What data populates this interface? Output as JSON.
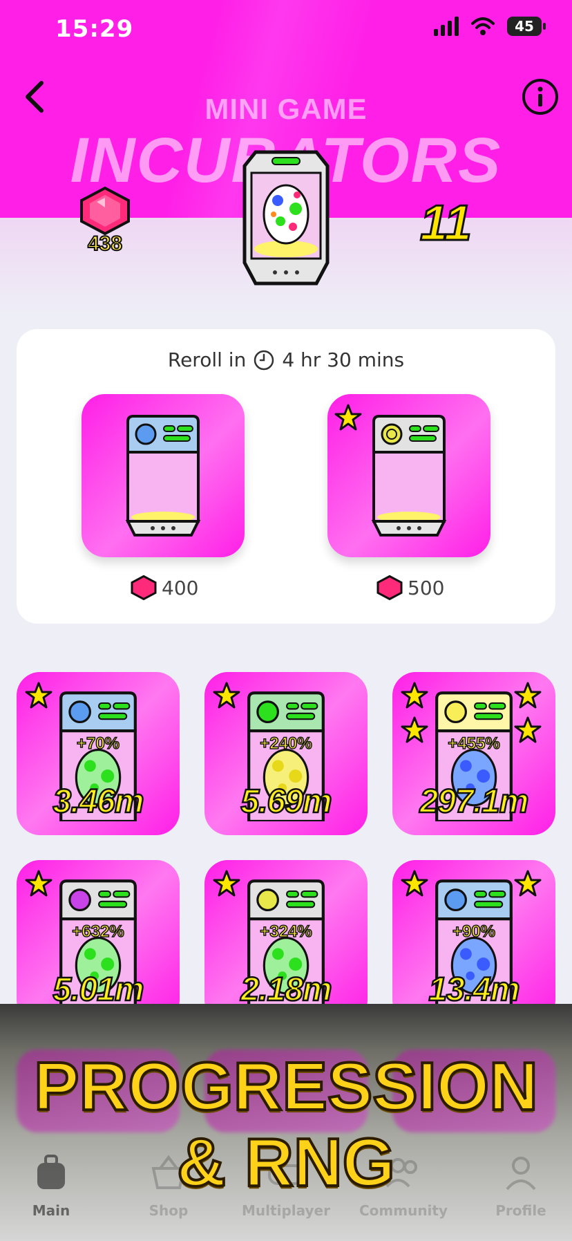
{
  "status": {
    "time": "15:29",
    "battery": "45"
  },
  "header": {
    "subtitle": "MINI GAME",
    "title": "INCUBATORS"
  },
  "balance": {
    "gems": "438",
    "level": "11"
  },
  "reroll": {
    "label": "Reroll in",
    "time": "4 hr 30 mins"
  },
  "shop": [
    {
      "price": "400",
      "starred": false,
      "accent": "#8fc3ff"
    },
    {
      "price": "500",
      "starred": true,
      "accent": "#e8e84a"
    }
  ],
  "incubators": [
    {
      "percent": "+70%",
      "value": "3.46m",
      "stars": 1
    },
    {
      "percent": "+240%",
      "value": "5.69m",
      "stars": 1
    },
    {
      "percent": "+455%",
      "value": "297.1m",
      "stars": 4
    },
    {
      "percent": "+632%",
      "value": "5.01m",
      "stars": 1
    },
    {
      "percent": "+324%",
      "value": "2.18m",
      "stars": 1
    },
    {
      "percent": "+90%",
      "value": "13.4m",
      "stars": 2
    }
  ],
  "nav": [
    {
      "label": "Main",
      "icon": "backpack-icon"
    },
    {
      "label": "Shop",
      "icon": "basket-icon"
    },
    {
      "label": "Multiplayer",
      "icon": "controller-icon"
    },
    {
      "label": "Community",
      "icon": "people-icon"
    },
    {
      "label": "Profile",
      "icon": "user-icon"
    }
  ],
  "promo": {
    "line1": "PROGRESSION",
    "line2": "& RNG"
  },
  "colors": {
    "hero": "#ff1fe7",
    "tile": "#ff1fe7",
    "value_text": "#ffee1c",
    "promo": "#ffd21a"
  }
}
